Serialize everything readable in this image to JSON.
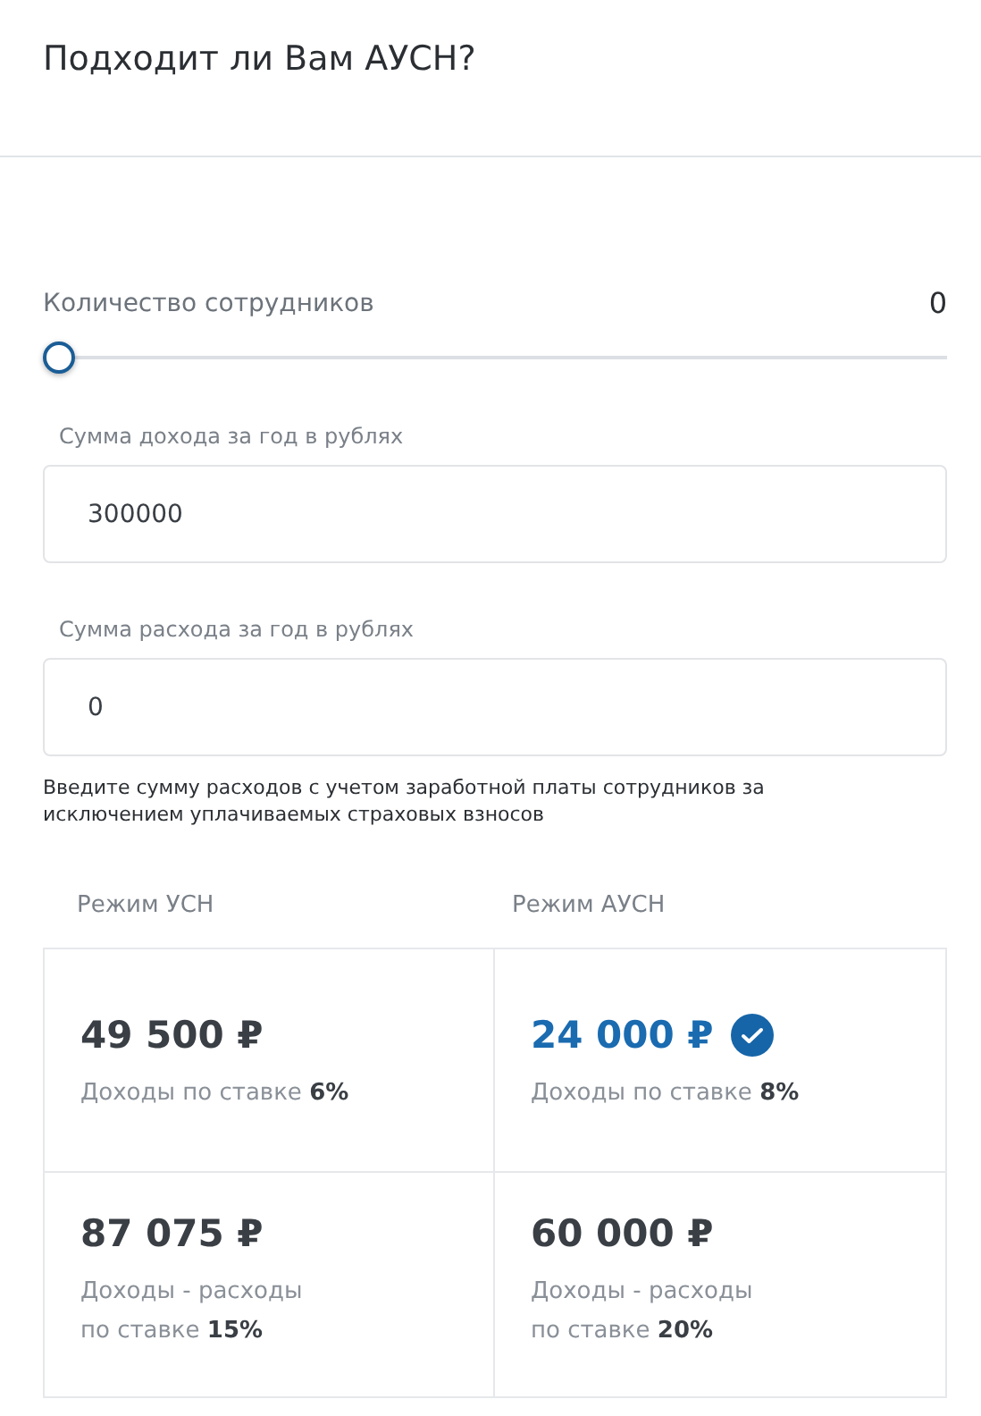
{
  "header": {
    "title": "Подходит ли Вам АУСН?"
  },
  "employees": {
    "label": "Количество сотрудников",
    "value": "0",
    "level": 0
  },
  "fields": [
    {
      "label": "Сумма дохода за год в рублях",
      "value": "300000"
    },
    {
      "label": "Сумма расхода за год в рублях",
      "value": "0"
    }
  ],
  "note": "Введите сумму расходов с учетом заработной платы сотрудников за исключением уплачиваемых страховых взносов",
  "results": {
    "columns": [
      "Режим УСН",
      "Режим АУСН"
    ],
    "rows": [
      [
        {
          "amount": "49 500 ₽",
          "description": [
            "Доходы по ставке **6%**"
          ],
          "best": false
        },
        {
          "amount": "24 000 ₽",
          "description": [
            "Доходы по ставке **8%**"
          ],
          "best": true
        }
      ],
      [
        {
          "amount": "87 075 ₽",
          "description": [
            "Доходы - расходы",
            "по ставке **15%**"
          ],
          "best": false
        },
        {
          "amount": "60 000 ₽",
          "description": [
            "Доходы - расходы",
            "по ставке **20%**"
          ],
          "best": false
        }
      ]
    ]
  }
}
